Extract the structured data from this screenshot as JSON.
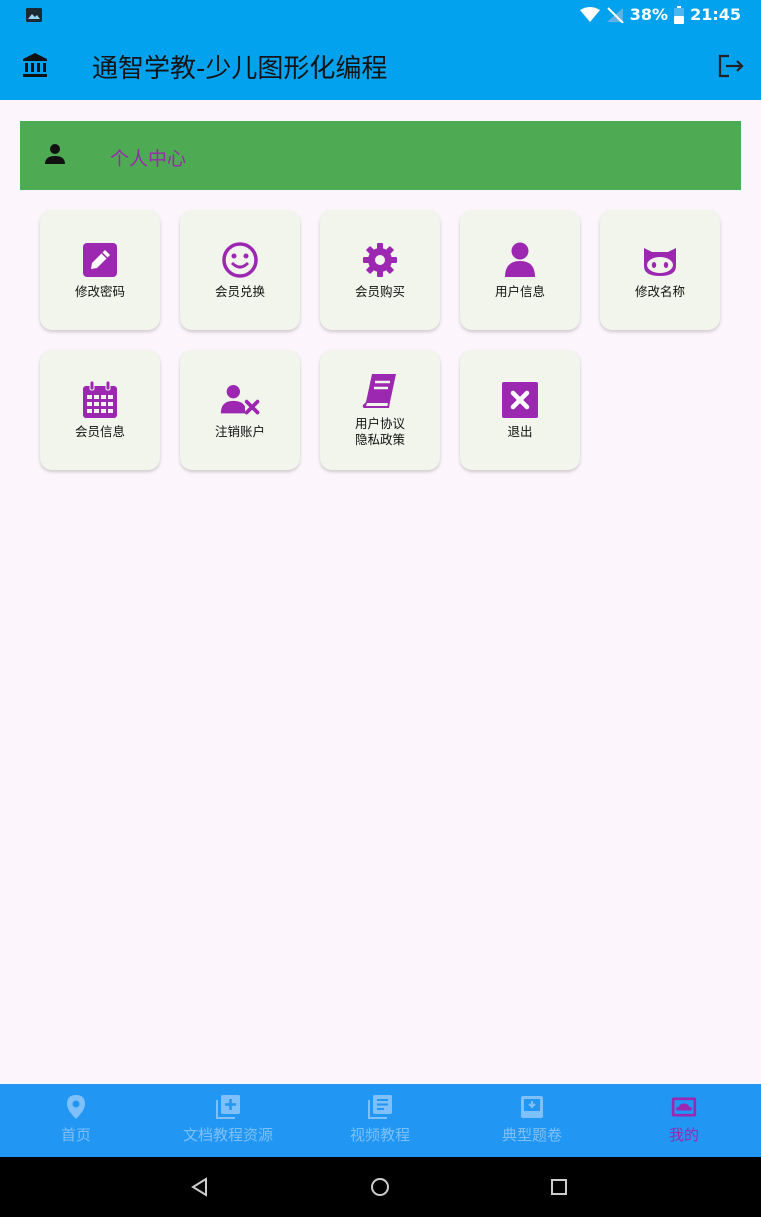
{
  "status_bar": {
    "battery": "38%",
    "time": "21:45"
  },
  "app_bar": {
    "title": "通智学教-少儿图形化编程"
  },
  "section": {
    "label": "个人中心"
  },
  "tiles": [
    {
      "label": "修改密码",
      "icon": "edit-icon"
    },
    {
      "label": "会员兑换",
      "icon": "smile-icon"
    },
    {
      "label": "会员购买",
      "icon": "gear-icon"
    },
    {
      "label": "用户信息",
      "icon": "user-icon"
    },
    {
      "label": "修改名称",
      "icon": "cat-icon"
    },
    {
      "label": "会员信息",
      "icon": "calendar-icon"
    },
    {
      "label": "注销账户",
      "icon": "user-remove-icon"
    },
    {
      "label": "用户协议\n隐私政策",
      "icon": "book-icon"
    },
    {
      "label": "退出",
      "icon": "close-box-icon"
    }
  ],
  "bottom_nav": [
    {
      "label": "首页",
      "icon": "location-icon"
    },
    {
      "label": "文档教程资源",
      "icon": "library-add-icon"
    },
    {
      "label": "视频教程",
      "icon": "library-books-icon"
    },
    {
      "label": "典型题卷",
      "icon": "box-icon"
    },
    {
      "label": "我的",
      "icon": "cloud-box-icon",
      "active": true
    }
  ],
  "colors": {
    "status_bar": "#03a2ef",
    "section_bg": "#4faa54",
    "accent": "#9c27b0",
    "tile_bg": "#f1f5eb",
    "bottom_nav_bg": "#2196f3",
    "nav_inactive": "#7ec0f7",
    "page_bg": "#fcf5fc"
  }
}
